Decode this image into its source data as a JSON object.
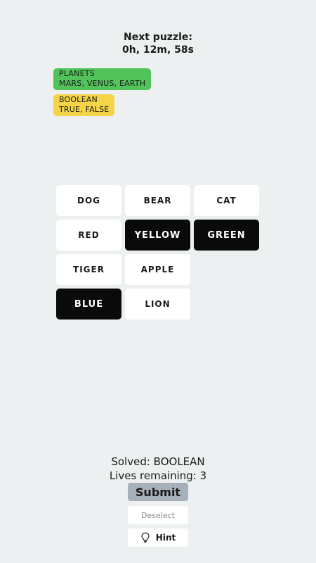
{
  "header": {
    "next_puzzle_label": "Next puzzle:",
    "countdown": "0h, 12m, 58s"
  },
  "solved_groups": [
    {
      "name": "PLANETS",
      "members": "MARS, VENUS, EARTH",
      "color": "#52c35b"
    },
    {
      "name": "BOOLEAN",
      "members": "TRUE, FALSE",
      "color": "#f5d547"
    }
  ],
  "tiles": [
    {
      "label": "DOG",
      "selected": false
    },
    {
      "label": "BEAR",
      "selected": false
    },
    {
      "label": "CAT",
      "selected": false
    },
    {
      "label": "RED",
      "selected": false
    },
    {
      "label": "YELLOW",
      "selected": true
    },
    {
      "label": "GREEN",
      "selected": true
    },
    {
      "label": "TIGER",
      "selected": false
    },
    {
      "label": "APPLE",
      "selected": false
    },
    {
      "label": "BLUE",
      "selected": true
    },
    {
      "label": "LION",
      "selected": false
    }
  ],
  "status": {
    "solved_text": "Solved: BOOLEAN",
    "lives_text": "Lives remaining: 3"
  },
  "buttons": {
    "submit_label": "Submit",
    "deselect_label": "Deselect",
    "hint_label": "Hint",
    "hint_icon": "lightbulb-icon"
  },
  "colors": {
    "background": "#ecf0f1",
    "tile": "#ffffff",
    "tile_selected": "#0a0a0a",
    "submit_disabled": "#a7b0b8"
  }
}
